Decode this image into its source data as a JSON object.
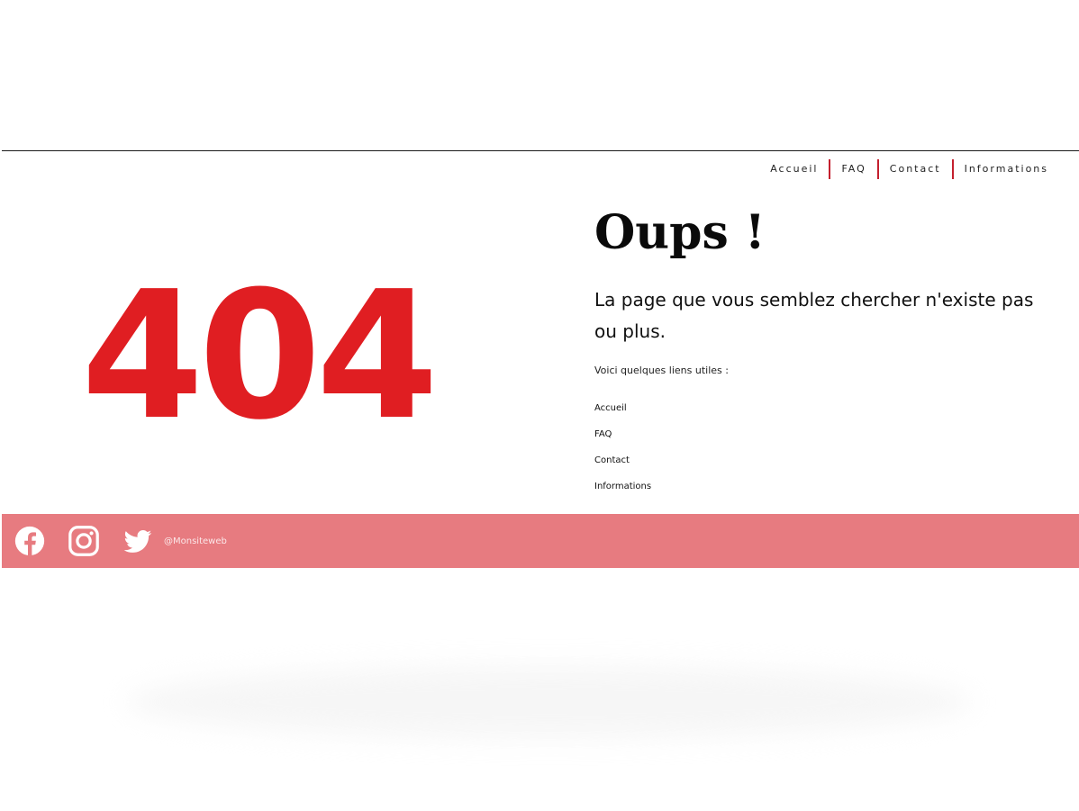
{
  "nav": {
    "items": [
      {
        "label": "Accueil"
      },
      {
        "label": "FAQ"
      },
      {
        "label": "Contact"
      },
      {
        "label": "Informations"
      }
    ],
    "separator_color": "#c4202e"
  },
  "error": {
    "code": "404",
    "code_color": "#e01e22",
    "title": "Oups !",
    "message": "La page que vous semblez chercher n'existe pas ou plus.",
    "links_intro": "Voici quelques liens utiles :",
    "links": [
      {
        "label": "Accueil"
      },
      {
        "label": "FAQ"
      },
      {
        "label": "Contact"
      },
      {
        "label": "Informations"
      }
    ]
  },
  "footer": {
    "background": "#e77b80",
    "social": [
      {
        "icon": "facebook-icon"
      },
      {
        "icon": "instagram-icon"
      },
      {
        "icon": "twitter-icon"
      }
    ],
    "handle": "@Monsiteweb"
  }
}
